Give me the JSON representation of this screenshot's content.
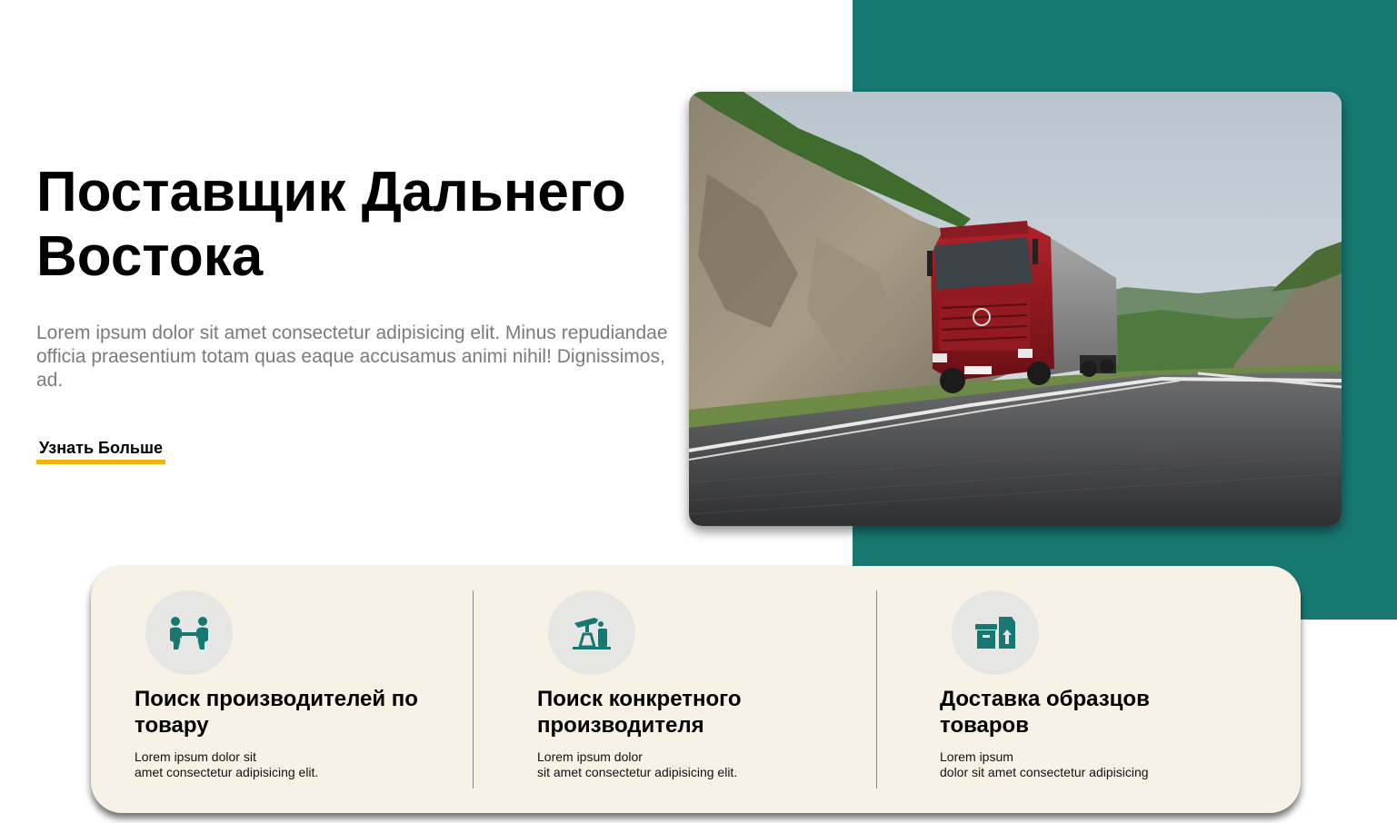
{
  "hero": {
    "title": "Поставщик Дальнего\nВостока",
    "description": "Lorem ipsum dolor sit amet consectetur adipisicing elit. Minus repudiandae officia praesentium totam quas eaque accusamus animi nihil! Dignissimos, ad.",
    "cta_label": "Узнать Больше"
  },
  "colors": {
    "accent_teal": "#177872",
    "cta_underline": "#f4b40e",
    "card_background": "#f8f1e6",
    "icon_circle": "#e6e6e4"
  },
  "hero_image": {
    "icon": "red-truck-on-highway-photo"
  },
  "features": [
    {
      "icon": "handshake-people-icon",
      "title": "Поиск производителей по товару",
      "desc_line1": "Lorem ipsum dolor sit",
      "desc_line2": "amet consectetur adipisicing elit."
    },
    {
      "icon": "oil-pump-icon",
      "title": "Поиск конкретного производителя",
      "desc_line1": "Lorem ipsum dolor",
      "desc_line2": "sit amet consectetur adipisicing elit."
    },
    {
      "icon": "boxes-upload-icon",
      "title": "Доставка образцов товаров",
      "desc_line1": "Lorem ipsum",
      "desc_line2": "dolor sit amet consectetur adipisicing"
    }
  ]
}
